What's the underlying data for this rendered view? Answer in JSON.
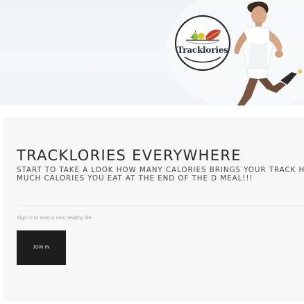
{
  "brand": {
    "wordmark": "Tracklories"
  },
  "hero": {
    "headline": "TRACKLORIES EVERYWHERE",
    "tagline": "START TO TAKE A LOOK HOW MANY CALORIES BRINGS YOUR TRACK HOW MUCH CALORIES YOU EAT AT THE END OF THE D MEAL!!!",
    "signin_hint": "Sign in to start a new healthy life",
    "join_label": "JOIN IN"
  },
  "colors": {
    "accent_button": "#1d1d1d",
    "card_background": "#f7f7f8",
    "logo_fruit_red": "#d9342b",
    "logo_fruit_green": "#8cc63e",
    "logo_fruit_yellow": "#e8c21c"
  },
  "icons": {
    "logo_emblem": "fruit-bowl-icon",
    "banner_photo": "runner-photo"
  }
}
